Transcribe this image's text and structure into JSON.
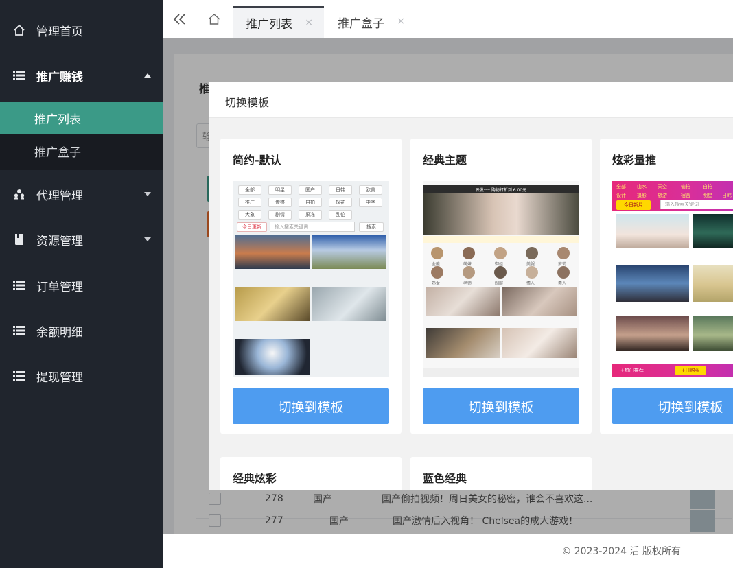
{
  "sidebar": {
    "items": [
      {
        "label": "管理首页",
        "icon": "home-icon"
      },
      {
        "label": "推广赚钱",
        "icon": "list-icon"
      },
      {
        "label": "代理管理",
        "icon": "agents-icon"
      },
      {
        "label": "资源管理",
        "icon": "book-icon"
      },
      {
        "label": "订单管理",
        "icon": "list-icon"
      },
      {
        "label": "余额明细",
        "icon": "list-icon"
      },
      {
        "label": "提现管理",
        "icon": "list-icon"
      }
    ],
    "submenu": [
      {
        "label": "推广列表",
        "active": true
      },
      {
        "label": "推广盒子",
        "active": false
      }
    ]
  },
  "topbar": {
    "tabs": [
      {
        "label": "推广列表",
        "active": true
      },
      {
        "label": "推广盒子",
        "active": false
      }
    ],
    "close_glyph": "×"
  },
  "page": {
    "title": "推广列表",
    "search_placeholder": "输入",
    "rows": [
      {
        "id": "278",
        "category": "国产",
        "title": "国产偷拍视频！周日美女的秘密，谁会不喜欢这..."
      },
      {
        "id": "277",
        "category": "国产",
        "title": "国产激情后入视角！ Chelsea的成人游戏！"
      }
    ]
  },
  "footer": {
    "text": "© 2023-2024 活 版权所有"
  },
  "modal": {
    "title": "切换模板",
    "button_label": "切换到模板",
    "templates": [
      {
        "name": "简约-默认"
      },
      {
        "name": "经典主题"
      },
      {
        "name": "炫彩量推"
      },
      {
        "name": "经典炫彩"
      },
      {
        "name": "蓝色经典"
      }
    ],
    "preview1": {
      "pills": [
        "全部",
        "明星",
        "国产",
        "日韩",
        "欧美",
        "推广",
        "传媒",
        "自拍",
        "探花",
        "中字",
        "大象",
        "剧情",
        "果冻",
        "乱伦"
      ],
      "today": "今日更新",
      "search_placeholder": "输入搜索关键词",
      "search_btn": "搜索"
    },
    "preview2": {
      "banner": "云发*** 购物打折到 6.00元",
      "circles": [
        "全能",
        "萌妹",
        "御姐",
        "美腿",
        "萝莉",
        "熟女",
        "老师",
        "制服",
        "情人",
        "素人"
      ]
    },
    "preview3": {
      "tags": [
        "全部",
        "山水",
        "天空",
        "偷拍",
        "自拍",
        "设计",
        "摄影",
        "旅游",
        "宿舍",
        "明星",
        "日韩"
      ],
      "today": "今日新片",
      "search_placeholder": "输入搜索关键词",
      "bottom_left": "+热门推荐",
      "bottom_right": "+日购买"
    }
  }
}
